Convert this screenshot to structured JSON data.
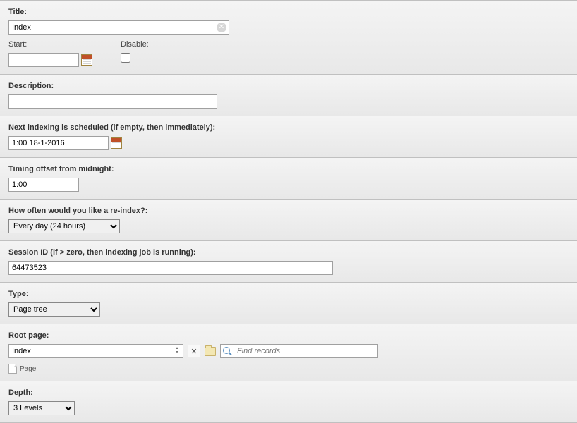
{
  "title": {
    "label": "Title:",
    "value": "Index"
  },
  "start": {
    "label": "Start:",
    "value": ""
  },
  "disable": {
    "label": "Disable:",
    "checked": false
  },
  "description": {
    "label": "Description:",
    "value": ""
  },
  "nextIndexing": {
    "label": "Next indexing is scheduled (if empty, then immediately):",
    "value": "1:00 18-1-2016"
  },
  "timingOffset": {
    "label": "Timing offset from midnight:",
    "value": "1:00"
  },
  "reindexFreq": {
    "label": "How often would you like a re-index?:",
    "selected": "Every day (24 hours)"
  },
  "sessionId": {
    "label": "Session ID (if > zero, then indexing job is running):",
    "value": "64473523"
  },
  "type": {
    "label": "Type:",
    "selected": "Page tree"
  },
  "rootPage": {
    "label": "Root page:",
    "selected": "Index",
    "findPlaceholder": "Find records",
    "pageLabel": "Page"
  },
  "depth": {
    "label": "Depth:",
    "selected": "3 Levels"
  }
}
